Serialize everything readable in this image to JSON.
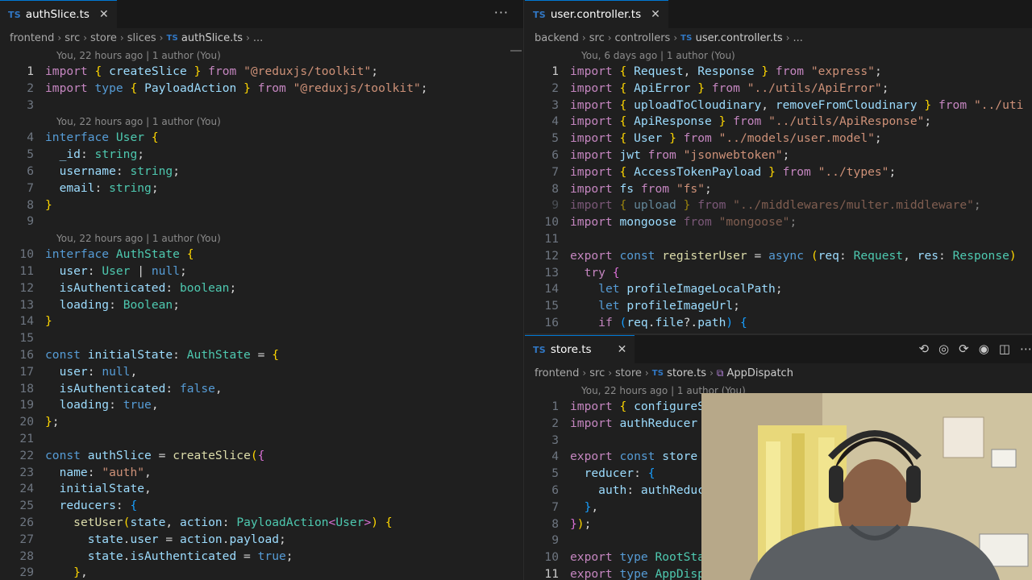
{
  "left": {
    "tab": {
      "badge": "TS",
      "label": "authSlice.ts",
      "close": "✕",
      "more": "···"
    },
    "breadcrumb": [
      "frontend",
      "src",
      "store",
      "slices"
    ],
    "breadcrumb_file": "authSlice.ts",
    "breadcrumb_tail": "...",
    "lenses": {
      "a": "You, 22 hours ago | 1 author (You)",
      "b": "You, 22 hours ago | 1 author (You)",
      "c": "You, 22 hours ago | 1 author (You)"
    },
    "line_numbers": [
      "1",
      "2",
      "3",
      "4",
      "5",
      "6",
      "7",
      "8",
      "9",
      "10",
      "11",
      "12",
      "13",
      "14",
      "15",
      "16",
      "17",
      "18",
      "19",
      "20",
      "21",
      "22",
      "23",
      "24",
      "25",
      "26",
      "27",
      "28",
      "29"
    ]
  },
  "right_top": {
    "tab": {
      "badge": "TS",
      "label": "user.controller.ts",
      "close": "✕"
    },
    "breadcrumb": [
      "backend",
      "src",
      "controllers"
    ],
    "breadcrumb_file": "user.controller.ts",
    "breadcrumb_tail": "...",
    "lens": "You, 6 days ago | 1 author (You)",
    "line_numbers": [
      "1",
      "2",
      "3",
      "4",
      "5",
      "6",
      "7",
      "8",
      "9",
      "10",
      "11",
      "12",
      "13",
      "14",
      "15",
      "16"
    ]
  },
  "right_bottom": {
    "tab": {
      "badge": "TS",
      "label": "store.ts",
      "close": "✕"
    },
    "breadcrumb": [
      "frontend",
      "src",
      "store"
    ],
    "breadcrumb_file": "store.ts",
    "breadcrumb_symbol": "AppDispatch",
    "lens": "You, 22 hours ago | 1 author (You)",
    "line_numbers": [
      "1",
      "2",
      "3",
      "4",
      "5",
      "6",
      "7",
      "8",
      "9",
      "10",
      "11"
    ]
  },
  "colors": {
    "background": "#1f1f1f",
    "keyword": "#c586c0",
    "type": "#4ec9b0",
    "string": "#ce9178",
    "variable": "#9cdcfe",
    "function": "#dcdcaa",
    "ts_badge": "#3178c6"
  },
  "icons": {
    "toolbar": [
      "go-back-icon",
      "go-forward-icon",
      "compare-icon",
      "copilot-icon",
      "split-editor-icon",
      "more-icon"
    ]
  }
}
